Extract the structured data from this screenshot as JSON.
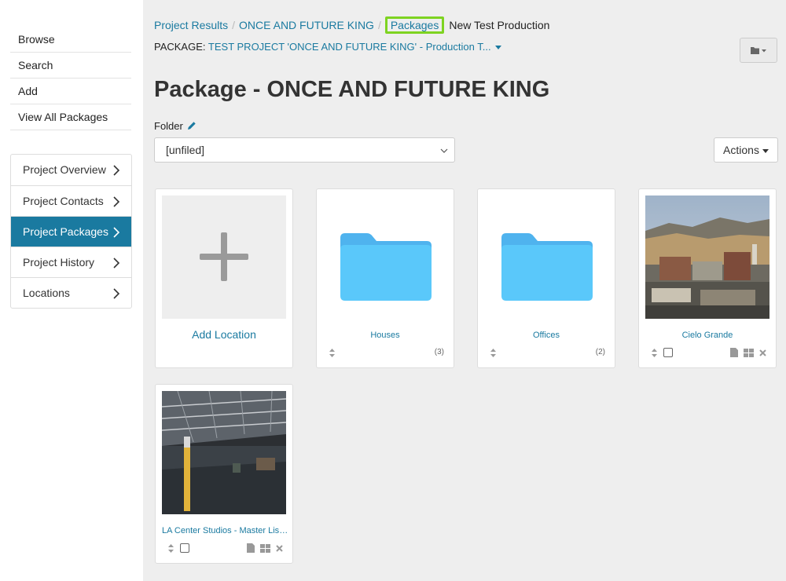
{
  "sidebar": {
    "top_links": [
      "Browse",
      "Search",
      "Add",
      "View All Packages"
    ],
    "project_nav": [
      {
        "label": "Project Overview",
        "active": false
      },
      {
        "label": "Project Contacts",
        "active": false
      },
      {
        "label": "Project Packages",
        "active": true
      },
      {
        "label": "Project History",
        "active": false
      },
      {
        "label": "Locations",
        "active": false
      }
    ]
  },
  "breadcrumb": {
    "items": [
      "Project Results",
      "ONCE AND FUTURE KING",
      "Packages"
    ],
    "current": "New Test Production"
  },
  "package": {
    "prefix": "PACKAGE:",
    "name": "TEST PROJECT 'ONCE AND FUTURE KING' - Production T..."
  },
  "page_title": "Package - ONCE AND FUTURE KING",
  "folder": {
    "label": "Folder",
    "selected": "[unfiled]"
  },
  "actions_label": "Actions",
  "cards": {
    "add": {
      "label": "Add Location"
    },
    "houses": {
      "label": "Houses",
      "count": "(3)"
    },
    "offices": {
      "label": "Offices",
      "count": "(2)"
    },
    "cielo": {
      "label": "Cielo Grande"
    },
    "la_center": {
      "label": "LA Center Studios - Master Listing"
    }
  },
  "colors": {
    "accent": "#1a7aa0",
    "highlight": "#7ed321",
    "folder_blue": "#5ac8fa"
  }
}
